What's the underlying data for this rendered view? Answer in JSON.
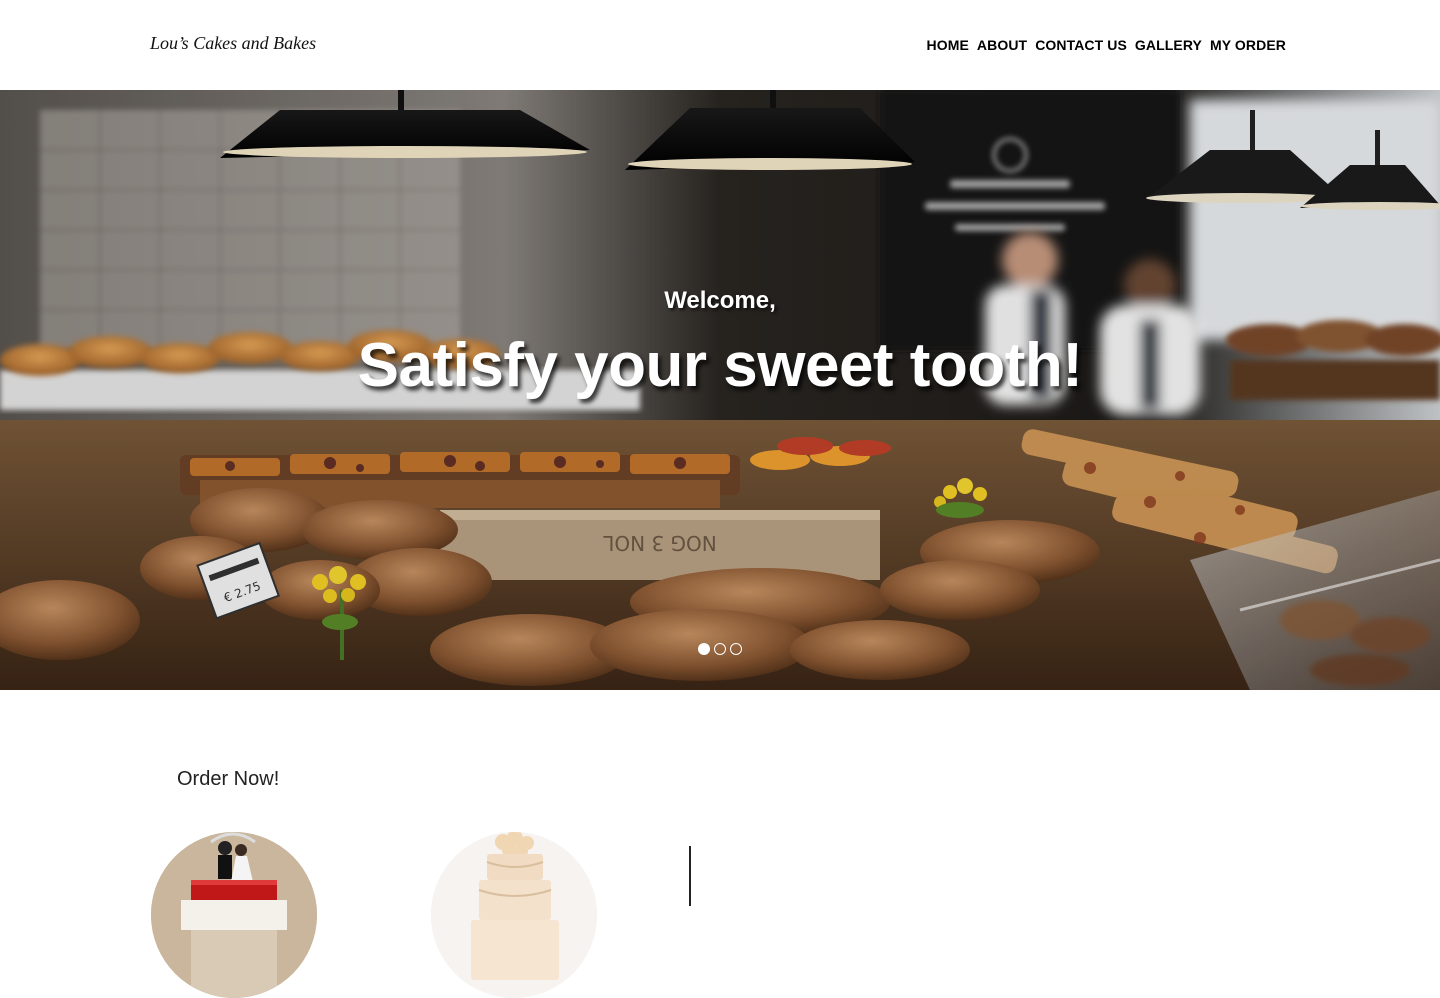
{
  "header": {
    "brand": "Lou’s Cakes and Bakes",
    "nav": [
      {
        "label": "HOME"
      },
      {
        "label": "ABOUT"
      },
      {
        "label": "CONTACT US"
      },
      {
        "label": "GALLERY"
      },
      {
        "label": "MY ORDER"
      }
    ]
  },
  "hero": {
    "welcome": "Welcome,",
    "heading": "Satisfy your sweet tooth!",
    "slide_count": 3,
    "active_slide": 1,
    "price_tag": "€ 2.75"
  },
  "order": {
    "title": "Order Now!"
  }
}
